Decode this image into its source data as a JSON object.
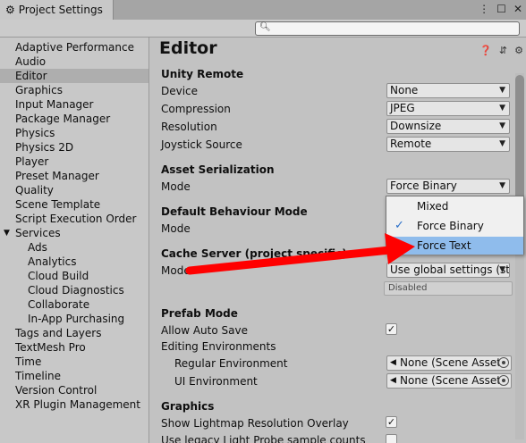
{
  "window": {
    "tab_title": "Project Settings",
    "icons": [
      "gear-icon",
      "kebab-menu-icon",
      "maximize-icon",
      "close-icon"
    ]
  },
  "search": {
    "placeholder": "",
    "value": ""
  },
  "sidebar": {
    "items": [
      {
        "label": "Adaptive Performance"
      },
      {
        "label": "Audio"
      },
      {
        "label": "Editor",
        "selected": true
      },
      {
        "label": "Graphics"
      },
      {
        "label": "Input Manager"
      },
      {
        "label": "Package Manager"
      },
      {
        "label": "Physics"
      },
      {
        "label": "Physics 2D"
      },
      {
        "label": "Player"
      },
      {
        "label": "Preset Manager"
      },
      {
        "label": "Quality"
      },
      {
        "label": "Scene Template"
      },
      {
        "label": "Script Execution Order"
      },
      {
        "label": "Services",
        "expanded": true
      },
      {
        "label": "Ads",
        "sub": true
      },
      {
        "label": "Analytics",
        "sub": true
      },
      {
        "label": "Cloud Build",
        "sub": true
      },
      {
        "label": "Cloud Diagnostics",
        "sub": true
      },
      {
        "label": "Collaborate",
        "sub": true
      },
      {
        "label": "In-App Purchasing",
        "sub": true
      },
      {
        "label": "Tags and Layers"
      },
      {
        "label": "TextMesh Pro"
      },
      {
        "label": "Time"
      },
      {
        "label": "Timeline"
      },
      {
        "label": "Version Control"
      },
      {
        "label": "XR Plugin Management"
      }
    ]
  },
  "main": {
    "title": "Editor",
    "unity_remote": {
      "header": "Unity Remote",
      "device_label": "Device",
      "device_value": "None",
      "compression_label": "Compression",
      "compression_value": "JPEG",
      "resolution_label": "Resolution",
      "resolution_value": "Downsize",
      "joystick_label": "Joystick Source",
      "joystick_value": "Remote"
    },
    "asset_serialization": {
      "header": "Asset Serialization",
      "mode_label": "Mode",
      "mode_value": "Force Binary"
    },
    "default_behaviour": {
      "header": "Default Behaviour Mode",
      "mode_label": "Mode"
    },
    "cache_server": {
      "header": "Cache Server (project specific)",
      "mode_label": "Mode",
      "mode_value": "Use global settings (st",
      "status": "Disabled"
    },
    "prefab_mode": {
      "header": "Prefab Mode",
      "allow_auto_save_label": "Allow Auto Save",
      "allow_auto_save_checked": true,
      "editing_env_label": "Editing Environments",
      "regular_env_label": "Regular Environment",
      "regular_env_value": "None (Scene Asset",
      "ui_env_label": "UI Environment",
      "ui_env_value": "None (Scene Asset"
    },
    "graphics": {
      "header": "Graphics",
      "lightmap_overlay_label": "Show Lightmap Resolution Overlay",
      "lightmap_overlay_checked": true,
      "legacy_probe_label": "Use legacy Light Probe sample counts",
      "legacy_probe_checked": false
    }
  },
  "popup": {
    "options": [
      {
        "label": "Mixed",
        "checked": false,
        "highlighted": false
      },
      {
        "label": "Force Binary",
        "checked": true,
        "highlighted": false
      },
      {
        "label": "Force Text",
        "checked": false,
        "highlighted": true
      }
    ]
  },
  "annotation": {
    "arrow_color": "#ff0000"
  }
}
